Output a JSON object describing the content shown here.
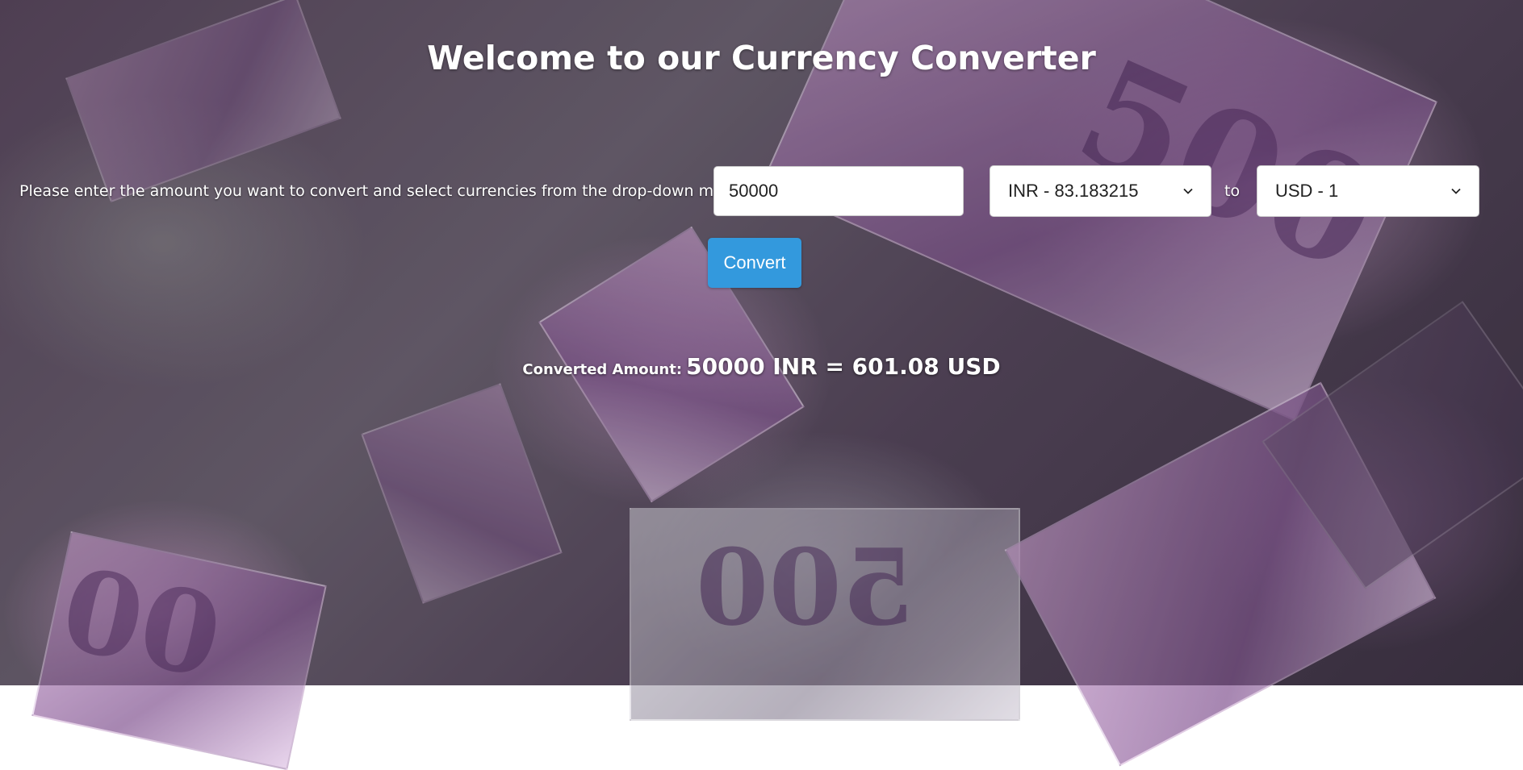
{
  "page": {
    "title": "Welcome to our Currency Converter"
  },
  "form": {
    "instruction": "Please enter the amount you want to convert and select currencies from the drop-down menus:",
    "amount_value": "50000",
    "from_currency": "INR - 83.183215",
    "to_label": "to",
    "to_currency": "USD - 1",
    "convert_label": "Convert"
  },
  "result": {
    "label": "Converted Amount:",
    "value": "50000 INR = 601.08 USD"
  },
  "colors": {
    "button": "#3399dd",
    "text": "#ffffff"
  }
}
